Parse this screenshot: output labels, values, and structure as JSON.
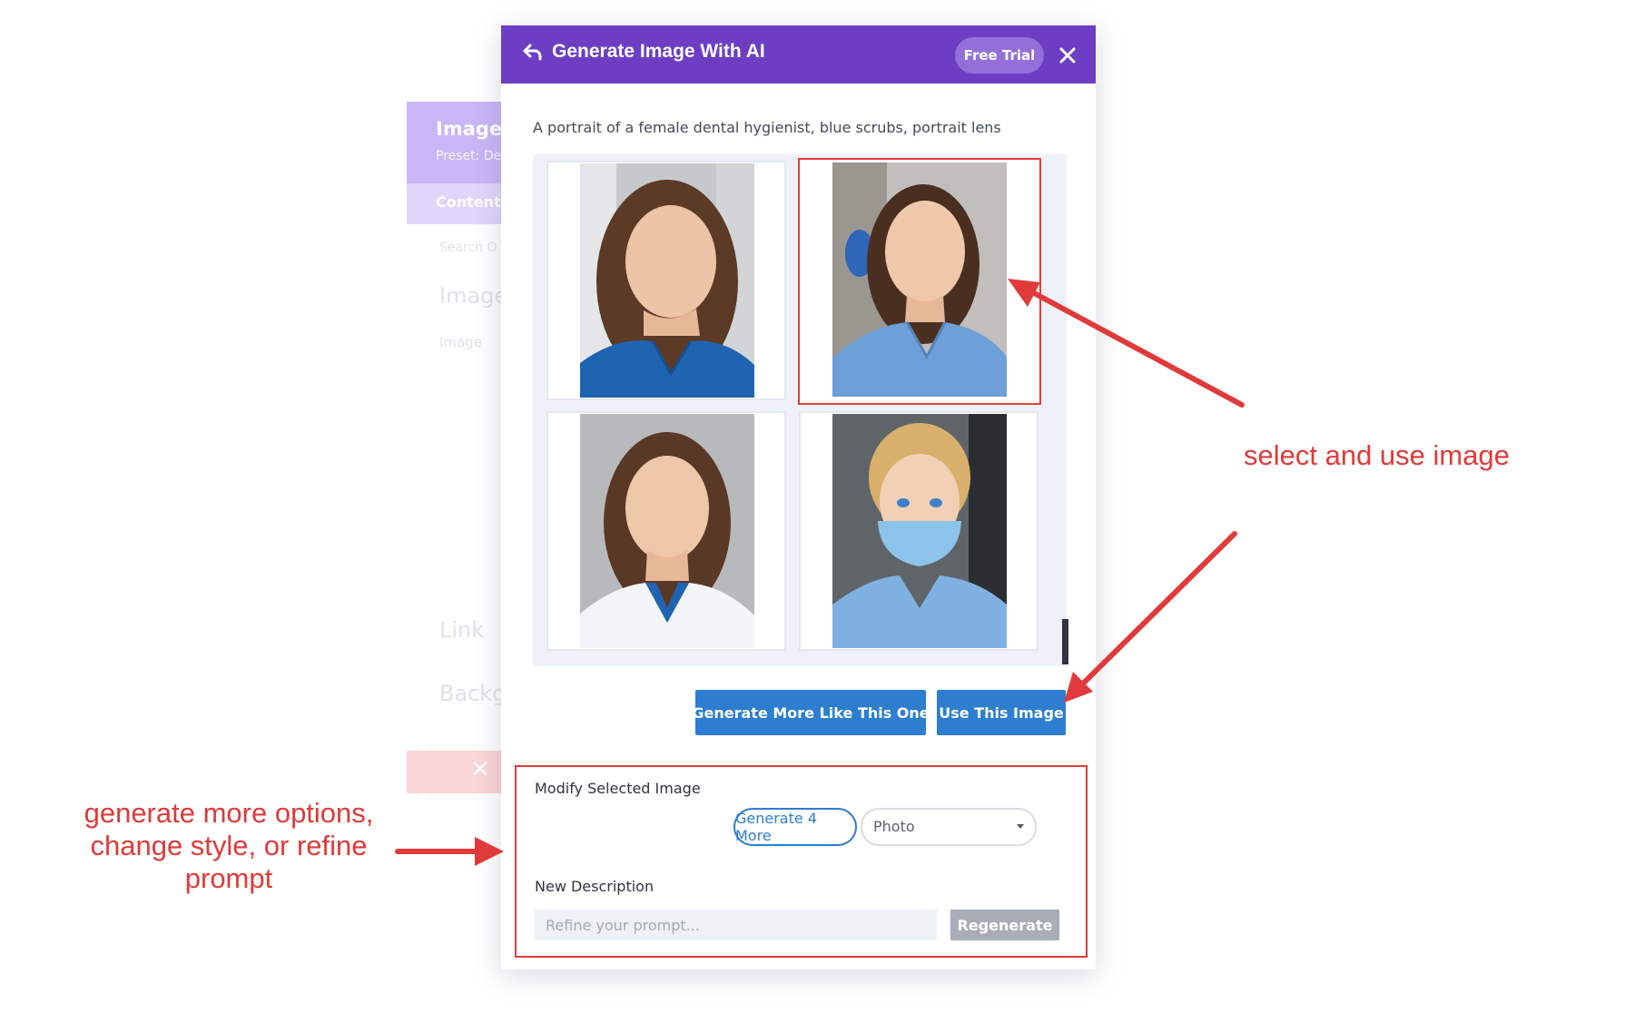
{
  "background_panel": {
    "title": "Image S",
    "preset": "Preset: De",
    "tab": "Content",
    "search": "Search O",
    "section_image": "Image",
    "field_image": "Image",
    "section_link": "Link",
    "section_background": "Backg"
  },
  "modal": {
    "title": "Generate Image With AI",
    "badge": "Free Trial",
    "prompt": "A portrait of a female dental hygienist, blue scrubs, portrait lens",
    "images": [
      {
        "description": "woman with long brown hair in dark blue scrubs, grey clinic background"
      },
      {
        "description": "woman with shoulder length brown hair in light blue scrubs, dental chair behind",
        "selected": true
      },
      {
        "description": "woman with long brown hair in white coat over blue scrubs"
      },
      {
        "description": "blonde woman wearing a blue surgical mask and light blue scrubs"
      }
    ],
    "actions": {
      "generate_more": "Generate More Like This One",
      "use_image": "Use This Image"
    },
    "modify": {
      "label": "Modify Selected Image",
      "generate_four": "Generate 4 More",
      "style_selected": "Photo",
      "new_description_label": "New Description",
      "refine_placeholder": "Refine your prompt...",
      "regenerate": "Regenerate"
    }
  },
  "annotations": {
    "select_use": "select and use image",
    "generate_more": "generate more options, change style, or refine prompt"
  },
  "colors": {
    "header_purple": "#6d3ec4",
    "button_blue": "#2d7ed0",
    "annotation_red": "#e03a3a"
  },
  "icons": [
    "back-arrow-icon",
    "close-icon",
    "dropdown-caret-icon",
    "close-x-icon"
  ]
}
